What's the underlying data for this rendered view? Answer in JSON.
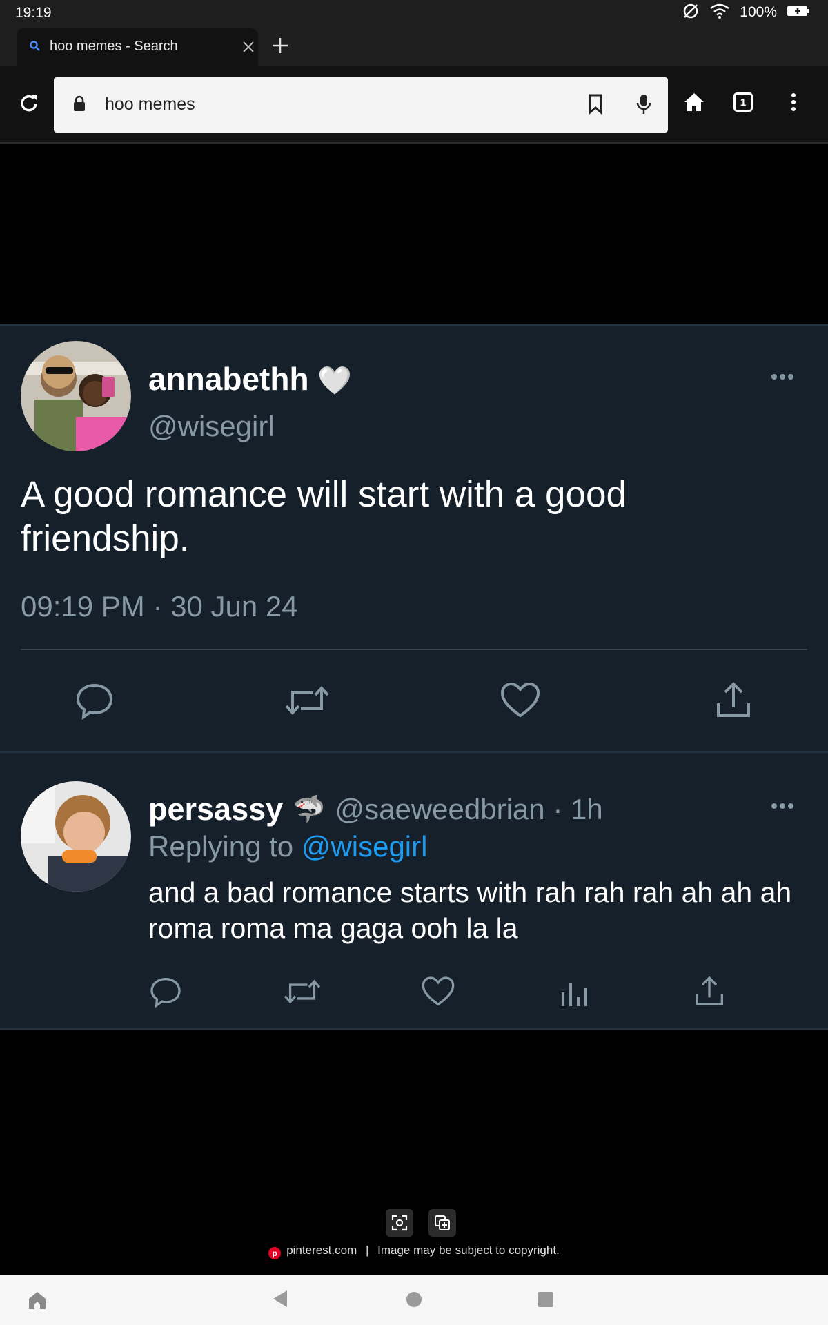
{
  "status_bar": {
    "time": "19:19",
    "battery": "100%"
  },
  "browser": {
    "tab_title": "hoo memes - Search",
    "omnibox_text": "hoo memes",
    "tab_count": "1"
  },
  "tweet": {
    "author_name": "annabethh",
    "author_emoji": "🤍",
    "handle": "@wisegirl",
    "text": "A good romance will start with a good friendship.",
    "timestamp": "09:19 PM · 30 Jun 24"
  },
  "reply": {
    "author_name": "persassy",
    "author_emoji": "🦈",
    "handle_time": "@saeweedbrian · 1h",
    "replying_prefix": "Replying to",
    "replying_mention": "@wisegirl",
    "text": "and a bad romance starts with rah rah rah ah ah ah roma roma ma gaga ooh la la"
  },
  "footer": {
    "source": "pinterest.com",
    "separator": "|",
    "copyright": "Image may be subject to copyright."
  },
  "colors": {
    "card_bg": "#15202b",
    "muted_text": "#8899a6",
    "mention": "#1d9bf0"
  }
}
